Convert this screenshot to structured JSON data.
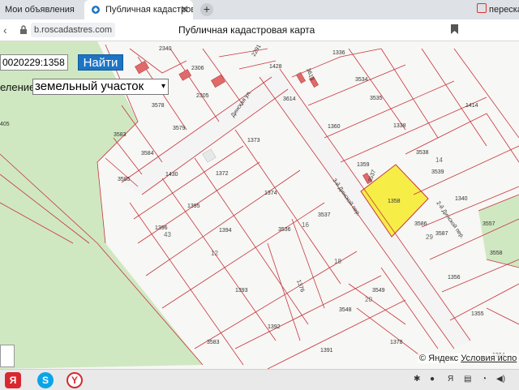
{
  "browser": {
    "tabs": [
      {
        "label": "Мои объявления"
      },
      {
        "label": "Публичная кадастровая"
      },
      {
        "label": "пересказ"
      }
    ],
    "url": "b.roscadastres.com",
    "page_title": "Публичная кадастровая карта"
  },
  "search": {
    "value": "0020229:1358",
    "button_label": "Найти"
  },
  "layer": {
    "label": "еление:",
    "selected": "земельный участок"
  },
  "map": {
    "highlight_color": "#f6ee46",
    "parcel_line_color": "#c8353a",
    "forest_color": "#cfe8c2",
    "streets": [
      "Динская ул.",
      "3-й Динской пер.",
      "2-й Динской пер."
    ],
    "parcels": [
      "2340",
      "2306",
      "2305",
      "1428",
      "1336",
      "2291",
      "3578",
      "3579",
      "3583",
      "3584",
      "3585",
      "1430",
      "1373",
      "1372",
      "1395",
      "1394",
      "1396",
      "43",
      "12",
      "1393",
      "1392",
      "1374",
      "3536",
      "16",
      "3537",
      "3534",
      "3535",
      "3614",
      "3613",
      "1359",
      "3537",
      "1360",
      "1338",
      "3538",
      "14",
      "3539",
      "1340",
      "1358",
      "3586",
      "3587",
      "29",
      "3557",
      "3558",
      "1356",
      "1376",
      "18",
      "3549",
      "20",
      "3548",
      "1355",
      "1378",
      "1391",
      "1364",
      "1414",
      "3583",
      "405"
    ],
    "copyright": "© Яндекс",
    "terms_link": "Условия испо"
  },
  "taskbar": {
    "apps": [
      "Я",
      "S",
      "Y"
    ]
  }
}
